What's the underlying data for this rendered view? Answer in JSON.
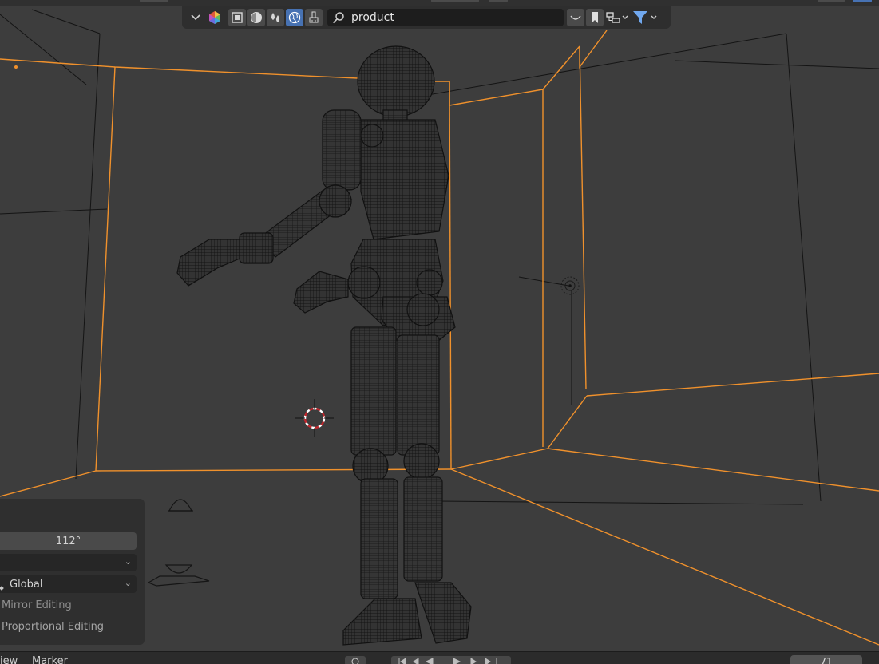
{
  "outliner": {
    "search_value": "product",
    "search_placeholder": "Search",
    "buttons": [
      "dropdown",
      "shading-display",
      "object-mode-select",
      "material-sphere",
      "mode-a",
      "world-globe",
      "brush"
    ],
    "filter_buttons": [
      "curve",
      "bookmark",
      "hierarchy",
      "filter"
    ]
  },
  "operator_panel": {
    "angle_value": "112°",
    "orientation_value": "Global",
    "mirror_editing_label": "Mirror Editing",
    "proportional_editing_label": "Proportional Editing"
  },
  "timeline": {
    "view_menu": "iew",
    "marker_menu": "Marker",
    "frame_value": "71"
  },
  "colors": {
    "selection_outline": "#f0912c",
    "viewport_bg": "#3d3d3d",
    "active_button": "#4772b3"
  }
}
